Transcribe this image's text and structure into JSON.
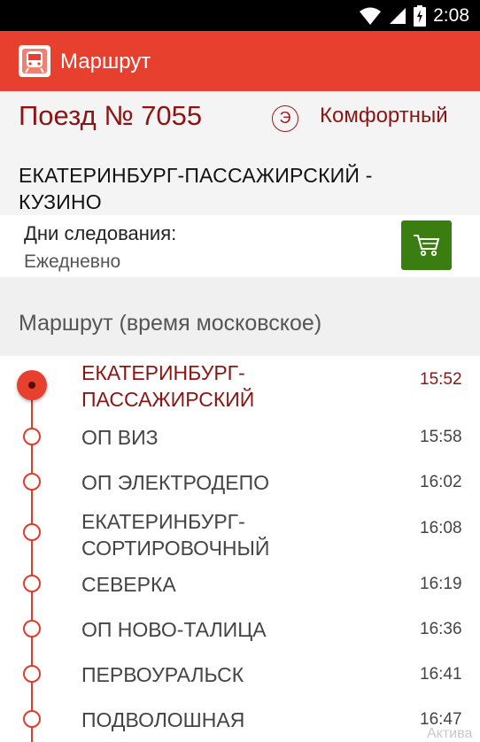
{
  "status_bar": {
    "time": "2:08"
  },
  "app_bar": {
    "title": "Маршрут"
  },
  "train": {
    "number": "Поезд № 7055",
    "class_icon": "Э",
    "class_label": "Комфортный",
    "route": "ЕКАТЕРИНБУРГ-ПАССАЖИРСКИЙ - КУЗИНО"
  },
  "days": {
    "label": "Дни следования:",
    "value": "Ежедневно"
  },
  "route_section": {
    "title": "Маршрут (время московское)"
  },
  "stops": [
    {
      "name": "ЕКАТЕРИНБУРГ-ПАССАЖИРСКИЙ",
      "time": "15:52"
    },
    {
      "name": "ОП ВИЗ",
      "time": "15:58"
    },
    {
      "name": "ОП ЭЛЕКТРОДЕПО",
      "time": "16:02"
    },
    {
      "name": "ЕКАТЕРИНБУРГ-СОРТИРОВОЧНЫЙ",
      "time": "16:08"
    },
    {
      "name": "СЕВЕРКА",
      "time": "16:19"
    },
    {
      "name": "ОП НОВО-ТАЛИЦА",
      "time": "16:36"
    },
    {
      "name": "ПЕРВОУРАЛЬСК",
      "time": "16:41"
    },
    {
      "name": "ПОДВОЛОШНАЯ",
      "time": "16:47"
    }
  ],
  "watermark": "Актива",
  "colors": {
    "app_bar": "#e8402f",
    "accent_dark": "#8b1515",
    "cart_button": "#3a7d10"
  },
  "icons": [
    "wifi-icon",
    "signal-icon",
    "battery-icon",
    "train-icon",
    "cart-icon"
  ]
}
